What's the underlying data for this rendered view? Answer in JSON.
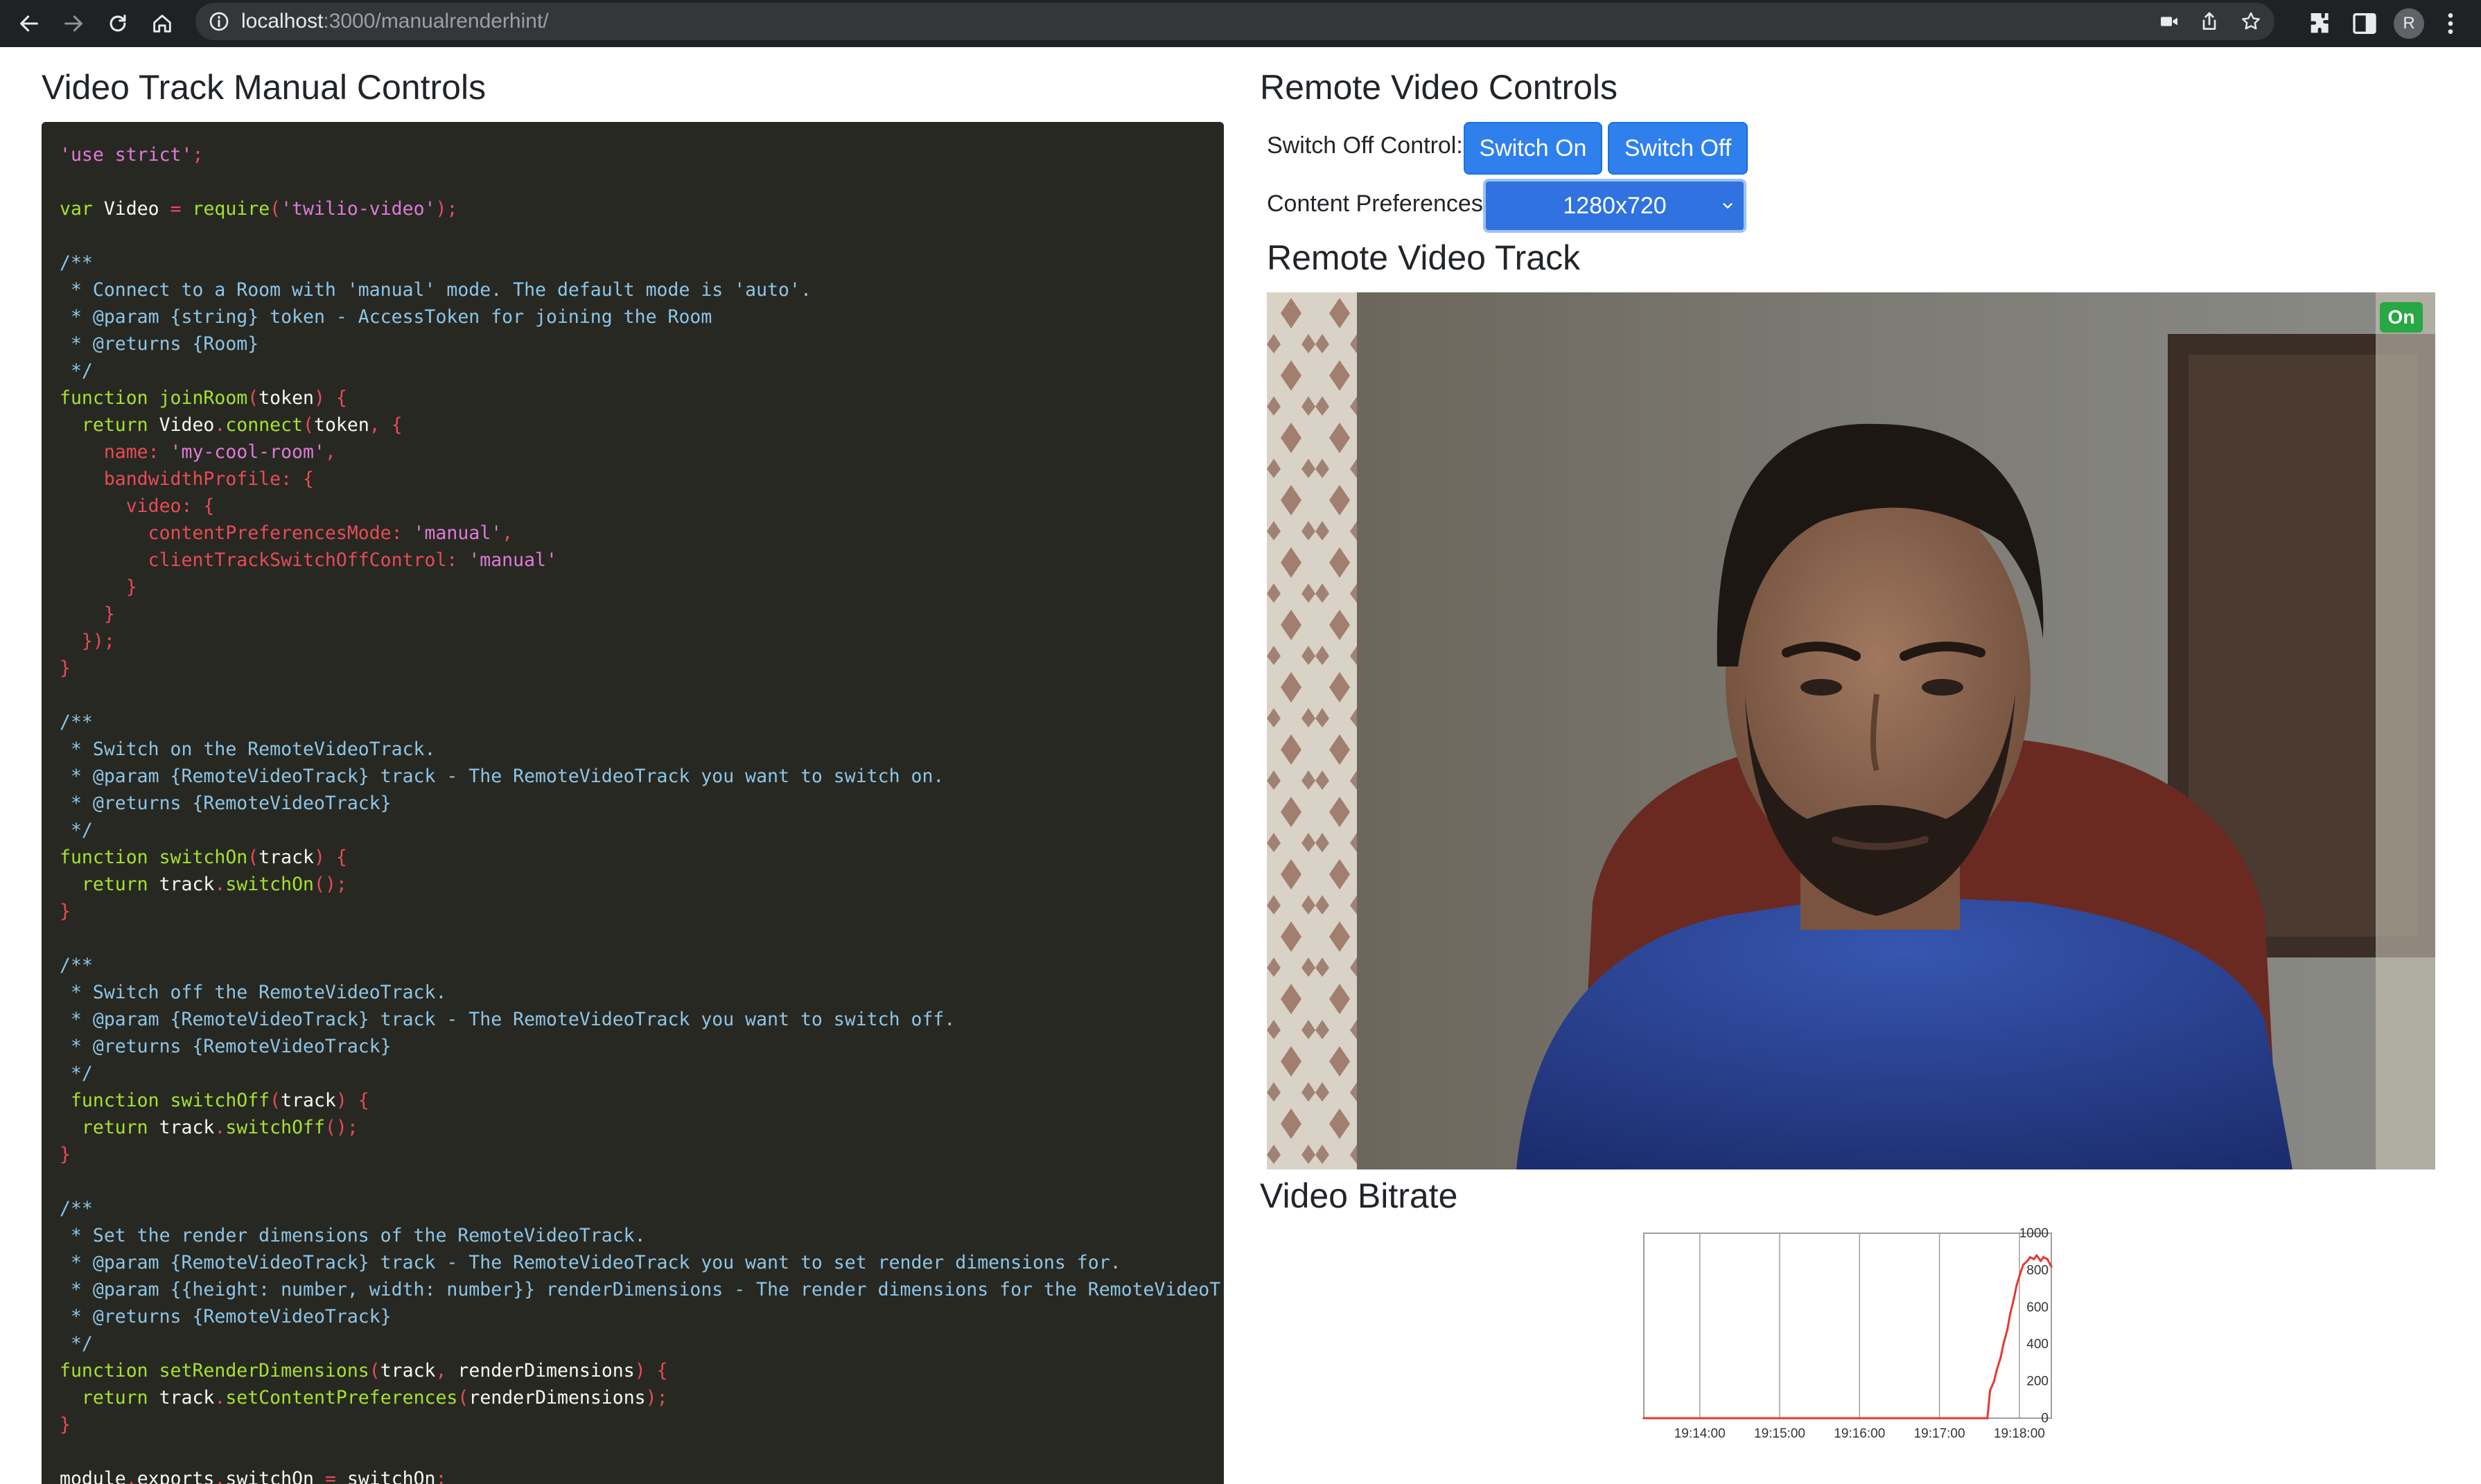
{
  "browser": {
    "url_host": "localhost",
    "url_path": ":3000/manualrenderhint/",
    "profile_initial": "R",
    "icons": [
      "back-icon",
      "forward-icon",
      "reload-icon",
      "home-icon",
      "info-icon",
      "camera-icon",
      "share-icon",
      "bookmark-star-icon",
      "extensions-icon",
      "side-panel-icon",
      "more-menu-icon"
    ]
  },
  "left": {
    "title": "Video Track Manual Controls"
  },
  "right": {
    "title": "Remote Video Controls",
    "switch_off_label": "Switch Off Control:",
    "switch_on_button": "Switch On",
    "switch_off_button": "Switch Off",
    "content_pref_label": "Content Preferences:",
    "content_pref_value": "1280x720",
    "remote_track_title": "Remote Video Track",
    "on_badge": "On",
    "bitrate_title": "Video Bitrate"
  },
  "colors": {
    "primary_button": "#2f80ed",
    "badge_green": "#28a745",
    "code_bg": "#272822",
    "chart_line": "#e53935"
  },
  "code_lines": [
    [
      [
        "'use strict'",
        "strp"
      ],
      [
        ";",
        "pu"
      ]
    ],
    [],
    [
      [
        "var ",
        "kw"
      ],
      [
        "Video ",
        "pl"
      ],
      [
        "= ",
        "pu"
      ],
      [
        "require",
        "kw"
      ],
      [
        "(",
        "pu"
      ],
      [
        "'twilio-video'",
        "strp"
      ],
      [
        ");",
        "pu"
      ]
    ],
    [],
    [
      [
        "/**",
        "cm"
      ]
    ],
    [
      [
        " * Connect to a Room with 'manual' mode. The default mode is 'auto'.",
        "cm"
      ]
    ],
    [
      [
        " * @param {string} token - AccessToken for joining the Room",
        "cm"
      ]
    ],
    [
      [
        " * @returns {Room}",
        "cm"
      ]
    ],
    [
      [
        " */",
        "cm"
      ]
    ],
    [
      [
        "function ",
        "kw"
      ],
      [
        "joinRoom",
        "kw"
      ],
      [
        "(",
        "pu"
      ],
      [
        "token",
        "pl"
      ],
      [
        ") {",
        "pu"
      ]
    ],
    [
      [
        "  return ",
        "kw"
      ],
      [
        "Video",
        "pl"
      ],
      [
        ".",
        "pu"
      ],
      [
        "connect",
        "kw"
      ],
      [
        "(",
        "pu"
      ],
      [
        "token",
        "pl"
      ],
      [
        ", {",
        "pu"
      ]
    ],
    [
      [
        "    name: ",
        "pu"
      ],
      [
        "'my-cool-room'",
        "strp"
      ],
      [
        ",",
        "pu"
      ]
    ],
    [
      [
        "    bandwidthProfile: {",
        "pu"
      ]
    ],
    [
      [
        "      video: {",
        "pu"
      ]
    ],
    [
      [
        "        contentPreferencesMode: ",
        "pu"
      ],
      [
        "'manual'",
        "strp"
      ],
      [
        ",",
        "pu"
      ]
    ],
    [
      [
        "        clientTrackSwitchOffControl: ",
        "pu"
      ],
      [
        "'manual'",
        "strp"
      ]
    ],
    [
      [
        "      }",
        "pu"
      ]
    ],
    [
      [
        "    }",
        "pu"
      ]
    ],
    [
      [
        "  });",
        "pu"
      ]
    ],
    [
      [
        "}",
        "pu"
      ]
    ],
    [],
    [
      [
        "/**",
        "cm"
      ]
    ],
    [
      [
        " * Switch on the RemoteVideoTrack.",
        "cm"
      ]
    ],
    [
      [
        " * @param {RemoteVideoTrack} track - The RemoteVideoTrack you want to switch on.",
        "cm"
      ]
    ],
    [
      [
        " * @returns {RemoteVideoTrack}",
        "cm"
      ]
    ],
    [
      [
        " */",
        "cm"
      ]
    ],
    [
      [
        "function ",
        "kw"
      ],
      [
        "switchOn",
        "kw"
      ],
      [
        "(",
        "pu"
      ],
      [
        "track",
        "pl"
      ],
      [
        ") {",
        "pu"
      ]
    ],
    [
      [
        "  return ",
        "kw"
      ],
      [
        "track",
        "pl"
      ],
      [
        ".",
        "pu"
      ],
      [
        "switchOn",
        "kw"
      ],
      [
        "();",
        "pu"
      ]
    ],
    [
      [
        "}",
        "pu"
      ]
    ],
    [],
    [
      [
        "/**",
        "cm"
      ]
    ],
    [
      [
        " * Switch off the RemoteVideoTrack.",
        "cm"
      ]
    ],
    [
      [
        " * @param {RemoteVideoTrack} track - The RemoteVideoTrack you want to switch off.",
        "cm"
      ]
    ],
    [
      [
        " * @returns {RemoteVideoTrack}",
        "cm"
      ]
    ],
    [
      [
        " */",
        "cm"
      ]
    ],
    [
      [
        " function ",
        "kw"
      ],
      [
        "switchOff",
        "kw"
      ],
      [
        "(",
        "pu"
      ],
      [
        "track",
        "pl"
      ],
      [
        ") {",
        "pu"
      ]
    ],
    [
      [
        "  return ",
        "kw"
      ],
      [
        "track",
        "pl"
      ],
      [
        ".",
        "pu"
      ],
      [
        "switchOff",
        "kw"
      ],
      [
        "();",
        "pu"
      ]
    ],
    [
      [
        "}",
        "pu"
      ]
    ],
    [],
    [
      [
        "/**",
        "cm"
      ]
    ],
    [
      [
        " * Set the render dimensions of the RemoteVideoTrack.",
        "cm"
      ]
    ],
    [
      [
        " * @param {RemoteVideoTrack} track - The RemoteVideoTrack you want to set render dimensions for.",
        "cm"
      ]
    ],
    [
      [
        " * @param {{height: number, width: number}} renderDimensions - The render dimensions for the RemoteVideoTrack.",
        "cm"
      ]
    ],
    [
      [
        " * @returns {RemoteVideoTrack}",
        "cm"
      ]
    ],
    [
      [
        " */",
        "cm"
      ]
    ],
    [
      [
        "function ",
        "kw"
      ],
      [
        "setRenderDimensions",
        "kw"
      ],
      [
        "(",
        "pu"
      ],
      [
        "track",
        "pl"
      ],
      [
        ", ",
        "pu"
      ],
      [
        "renderDimensions",
        "pl"
      ],
      [
        ") {",
        "pu"
      ]
    ],
    [
      [
        "  return ",
        "kw"
      ],
      [
        "track",
        "pl"
      ],
      [
        ".",
        "pu"
      ],
      [
        "setContentPreferences",
        "kw"
      ],
      [
        "(",
        "pu"
      ],
      [
        "renderDimensions",
        "pl"
      ],
      [
        ");",
        "pu"
      ]
    ],
    [
      [
        "}",
        "pu"
      ]
    ],
    [],
    [
      [
        "module",
        "pl"
      ],
      [
        ".",
        "pu"
      ],
      [
        "exports",
        "pl"
      ],
      [
        ".",
        "pu"
      ],
      [
        "switchOn ",
        "pl"
      ],
      [
        "= ",
        "pu"
      ],
      [
        "switchOn",
        "pl"
      ],
      [
        ";",
        "pu"
      ]
    ]
  ],
  "chart_data": {
    "type": "line",
    "title": "",
    "xlabel": "",
    "ylabel": "",
    "ylim": [
      0,
      1000
    ],
    "yticks": [
      "1000",
      "800",
      "600",
      "400",
      "200",
      "0"
    ],
    "xticks": [
      "19:14:00",
      "19:15:00",
      "19:16:00",
      "19:17:00",
      "19:18:00"
    ],
    "grid": "vertical",
    "series": [
      {
        "x": [
          "19:13:18",
          "19:14:00",
          "19:15:00",
          "19:16:00",
          "19:17:00",
          "19:17:36",
          "19:17:38",
          "19:17:41",
          "19:17:43",
          "19:17:46",
          "19:17:48",
          "19:17:51",
          "19:17:53",
          "19:17:56",
          "19:17:58",
          "19:18:01",
          "19:18:03",
          "19:18:06",
          "19:18:08",
          "19:18:11",
          "19:18:13",
          "19:18:16",
          "19:18:18",
          "19:18:21",
          "19:18:24"
        ],
        "values": [
          0,
          0,
          0,
          0,
          0,
          0,
          150,
          200,
          260,
          330,
          400,
          480,
          560,
          650,
          720,
          790,
          830,
          850,
          870,
          860,
          880,
          850,
          870,
          860,
          820
        ]
      }
    ]
  }
}
